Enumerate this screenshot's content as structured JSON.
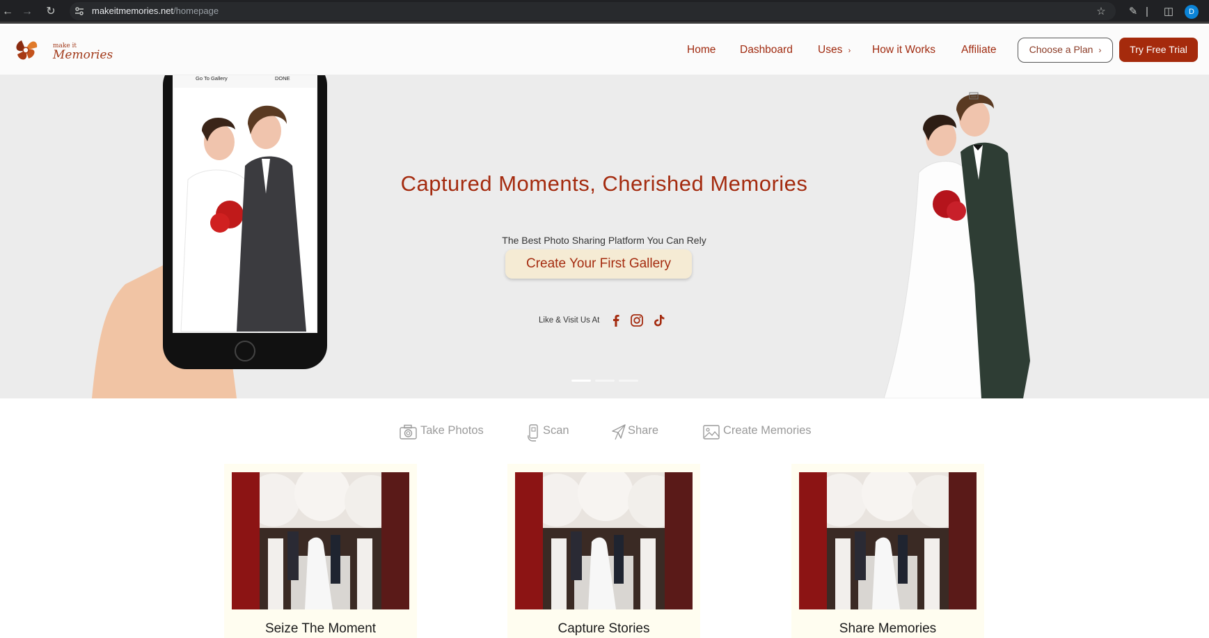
{
  "browser": {
    "url_host": "makeitmemories.net",
    "url_path": "/homepage",
    "profile_initial": "D"
  },
  "header": {
    "logo_small": "make it",
    "logo_main": "Memories",
    "nav": {
      "home": "Home",
      "dashboard": "Dashboard",
      "uses": "Uses",
      "how_it_works": "How it Works",
      "affiliate": "Affiliate"
    },
    "choose_plan": "Choose a Plan",
    "try_free_trial": "Try Free Trial"
  },
  "hero": {
    "title": "Captured Moments, Cherished Memories",
    "subtitle": "The Best Photo Sharing Platform You Can Rely",
    "cta": "Create Your First Gallery",
    "social_label": "Like & Visit Us At",
    "phone_back_label": "Go To Gallery",
    "phone_done_label": "DONE",
    "slides": 3,
    "active_slide": 1
  },
  "features": {
    "tabs": [
      "Take Photos",
      "Scan",
      "Share",
      "Create Memories"
    ]
  },
  "cards": [
    {
      "title": "Seize The Moment"
    },
    {
      "title": "Capture Stories"
    },
    {
      "title": "Share Memories"
    }
  ],
  "colors": {
    "brand": "#a42b0f",
    "hero_bg": "#ececec",
    "cta_bg": "#f5ebd4",
    "card_bg": "#fffdf0"
  }
}
